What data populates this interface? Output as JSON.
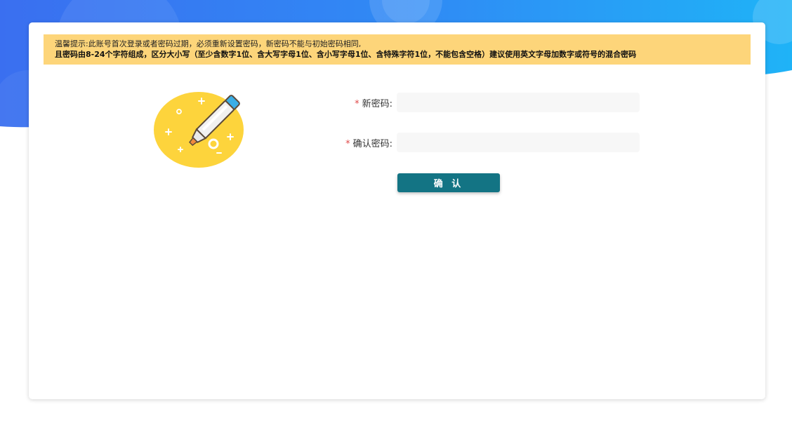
{
  "notice": {
    "line1": "温馨提示:此账号首次登录或者密码过期，必须重新设置密码，新密码不能与初始密码相同,",
    "line2": "且密码由8-24个字符组成，区分大小写（至少含数字1位、含大写字母1位、含小写字母1位、含特殊字符1位，不能包含空格）建议使用英文字母加数字或符号的混合密码"
  },
  "form": {
    "required_mark": "*",
    "new_password_label": "新密码:",
    "confirm_password_label": "确认密码:",
    "new_password_value": "",
    "confirm_password_value": "",
    "submit_label": "确 认"
  },
  "colors": {
    "accent": "#137484",
    "notice_bg": "#fdd57a",
    "background_blue": "#3d7cf0",
    "required": "#e04a4a"
  },
  "icons": {
    "illustration": "highlighter-pen-icon"
  }
}
